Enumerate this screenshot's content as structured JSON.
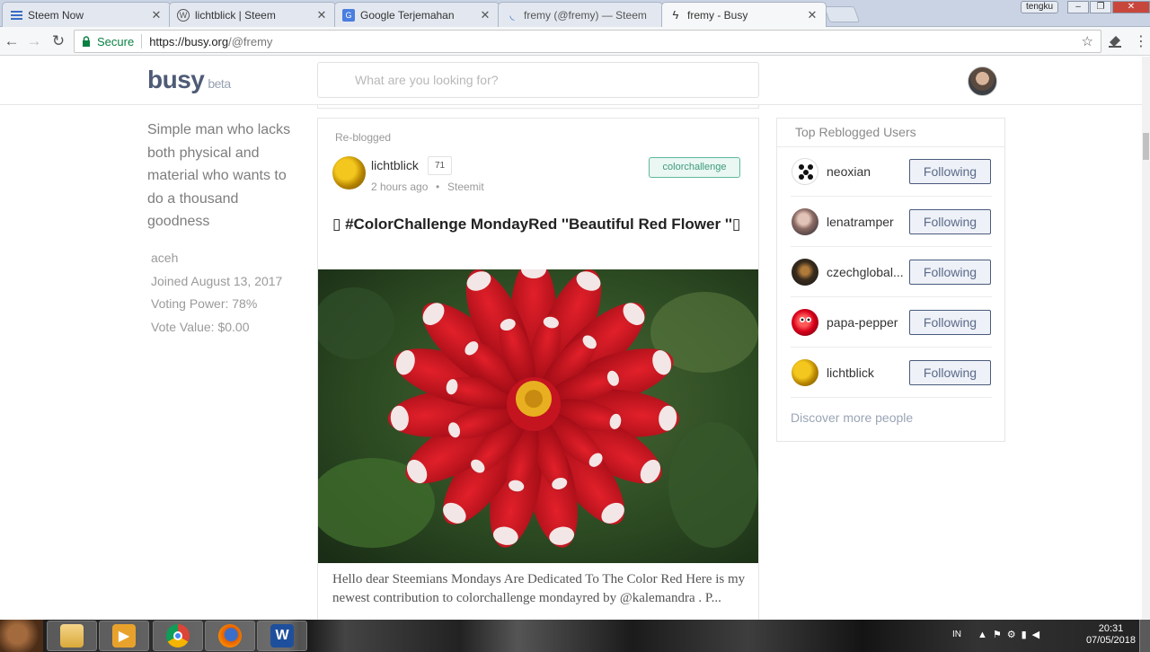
{
  "browser": {
    "tabs": [
      {
        "label": "Steem Now",
        "icon": "list-icon"
      },
      {
        "label": "lichtblick | Steem",
        "icon": "wordpress-icon"
      },
      {
        "label": "Google Terjemahan",
        "icon": "translate-icon"
      },
      {
        "label": "fremy (@fremy) — Steem",
        "icon": "steem-icon"
      },
      {
        "label": "fremy - Busy",
        "icon": "bolt-icon",
        "active": true
      }
    ],
    "user_badge": "tengku",
    "secure_label": "Secure",
    "url_host": "https://busy.org",
    "url_path": "/@fremy"
  },
  "header": {
    "logo": "busy",
    "logo_beta": "beta",
    "search_placeholder": "What are you looking for?"
  },
  "profile": {
    "bio": "Simple man who lacks both physical and material who wants to do a thousand goodness",
    "location": "aceh",
    "joined": "Joined August 13, 2017",
    "voting_power": "Voting Power: 78%",
    "vote_value": "Vote Value: $0.00"
  },
  "post": {
    "reblogged_label": "Re-blogged",
    "author": "lichtblick",
    "reputation": "71",
    "time": "2 hours ago",
    "dot": "•",
    "app": "Steemit",
    "tag": "colorchallenge",
    "title": "▯ #ColorChallenge MondayRed ''Beautiful Red Flower ''▯",
    "body": "Hello dear Steemians Mondays Are Dedicated To The Color Red Here is my newest contribution to colorchallenge mondayred by @kalemandra . P..."
  },
  "sidebar": {
    "title": "Top Reblogged Users",
    "users": [
      {
        "name": "neoxian",
        "button": "Following"
      },
      {
        "name": "lenatramper",
        "button": "Following"
      },
      {
        "name": "czechglobal...",
        "button": "Following"
      },
      {
        "name": "papa-pepper",
        "button": "Following"
      },
      {
        "name": "lichtblick",
        "button": "Following"
      }
    ],
    "discover": "Discover more people"
  },
  "taskbar": {
    "language": "IN",
    "time": "20:31",
    "date": "07/05/2018"
  }
}
